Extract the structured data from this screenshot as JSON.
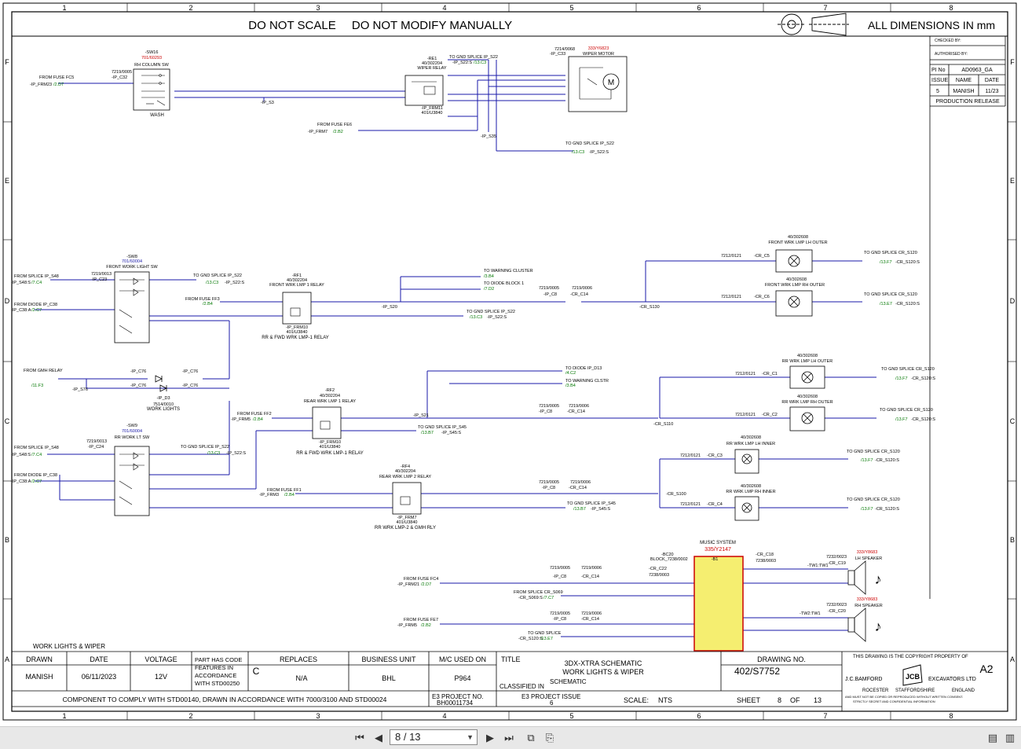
{
  "header": {
    "do_not_scale": "DO NOT SCALE",
    "do_not_modify": "DO NOT MODIFY MANUALLY",
    "dimensions": "ALL DIMENSIONS IN mm"
  },
  "grid": {
    "columns": [
      "1",
      "2",
      "3",
      "4",
      "5",
      "6",
      "7",
      "8"
    ],
    "rows": [
      "F",
      "E",
      "D",
      "C",
      "B",
      "A"
    ]
  },
  "revision_block": {
    "checked_by": "CHECKED BY:",
    "authorised_by": "AUTHORISED BY:",
    "pi_no_label": "PI No",
    "pi_no": "AD0963_GA",
    "issue_label": "ISSUE",
    "name_label": "NAME",
    "date_label": "DATE",
    "issue": "5",
    "name": "MANISH",
    "date": "11/23",
    "production_release": "PRODUCTION RELEASE"
  },
  "sheet_label": "WORK LIGHTS & WIPER",
  "components": {
    "sw16": {
      "ref": "-SW16",
      "part": "701/60293",
      "name": "RH COLUMN SW",
      "sub": "WASH"
    },
    "re1": {
      "ref": "-RE1",
      "part": "40/302204",
      "name": "WIPER RELAY",
      "conn": "-IP_FRM11",
      "conn_part": "401/U3840"
    },
    "wiper_motor": {
      "ref": "-IP_C33",
      "code": "7214/0068",
      "part": "333/Y6823",
      "name": "WIPER MOTOR"
    },
    "sw8": {
      "ref": "-SW8",
      "part": "701/60004",
      "name": "FRONT WORK LIGHT SW"
    },
    "rf1": {
      "ref": "-RF1",
      "part": "40/302204",
      "name": "FRONT WRK LMP 1 RELAY",
      "conn": "-IP_FRM10",
      "conn_part": "401/U3840",
      "caption": "RR & FWD WRK LMP-1 RELAY"
    },
    "d3": {
      "ref": "-IP_D3",
      "part": "7514/0010",
      "name": "WORK LIGHTS"
    },
    "sw9": {
      "ref": "-SW9",
      "part": "701/60004",
      "name": "RR WORK LT SW"
    },
    "rf2": {
      "ref": "-RF2",
      "part": "40/302204",
      "name": "REAR WRK LMP 1 RELAY",
      "conn": "-IP_FRM10",
      "conn_part": "401/U3840",
      "caption": "RR & FWD WRK LMP-1 RELAY"
    },
    "rf4": {
      "ref": "-RF4",
      "part": "40/302204",
      "name": "REAR WRK LMP 2 RELAY",
      "conn": "-IP_FRM7",
      "conn_part": "401/U3840",
      "caption": "RR WRK LMP-2 & GMH RLY"
    },
    "lamps": [
      {
        "part": "40/302608",
        "name": "FRONT WRK LMP LH OUTER",
        "conn": "-CR_C5"
      },
      {
        "part": "40/302608",
        "name": "FRONT WRK LMP RH OUTER",
        "conn": "-CR_C6"
      },
      {
        "part": "40/302608",
        "name": "RR WRK LMP LH OUTER",
        "conn": "-CR_C1"
      },
      {
        "part": "40/302608",
        "name": "RR WRK LMP RH OUTER",
        "conn": "-CR_C2"
      },
      {
        "part": "40/302608",
        "name": "RR WRK LMP LH INNER",
        "conn": "-CR_C3"
      },
      {
        "part": "40/302608",
        "name": "RR WRK LMP RH INNER",
        "conn": "-CR_C4"
      }
    ],
    "music": {
      "title": "MUSIC SYSTEM",
      "part": "335/Y2147",
      "ref": "-B1",
      "bc": "-BC20",
      "block": "BLOCK_7238/0002"
    },
    "lh_speaker": {
      "part": "333/Y8683",
      "name": "LH SPEAKER",
      "conn": "-CR_C19"
    },
    "rh_speaker": {
      "part": "333/Y8683",
      "name": "RH SPEAKER",
      "conn": "-CR_C20"
    }
  },
  "refs": {
    "from_fuse_fc5": "FROM FUSE FC5",
    "ip_frm23": "-IP_FRM23",
    "ref_2d7": "/2.D7",
    "from_fuse_fe6": "FROM FUSE FE6",
    "ip_frm7": "-IP_FRM7",
    "ref_2b2": "/2.B2",
    "to_gnd_splice_ip_s22": "TO GND SPLICE IP_S22",
    "ref_13c3": "/13.C3",
    "ip_s22s": "-IP_S22:S",
    "ip_s3": "-IP_S3",
    "ip_s35": "-IP_S35",
    "ip_s20": "-IP_S20",
    "ip_s21": "-IP_S21",
    "ip_s76": "-IP_S76",
    "from_splice_ip_s48": "FROM SPLICE IP_S48",
    "ip_s48s": "-IP_S48:S",
    "ref_7c4": "/7.C4",
    "from_diode_ip_c38": "FROM DIODE IP_C38",
    "ip_c38a": "-IP_C38:A",
    "ref_2c7": "/2.C7",
    "from_fuse_ff3": "FROM FUSE FF3",
    "ref_2b4": "/2.B4",
    "to_warning_cluster": "TO WARNING CLUSTER",
    "ref_3b4": "/3.B4",
    "to_diode_block1": "TO DIODE BLOCK 1",
    "ref_7d2": "/7.D2",
    "from_gmh_relay": "FROM GMH RELAY",
    "ref_11f3": "/11.F3",
    "ip_c76": "-IP_C76",
    "to_diode_ip_d13": "TO DIODE IP_D13",
    "ref_4c2": "/4.C2",
    "to_warning_clstr": "TO WARNING CLSTR",
    "from_fuse_ff2": "FROM FUSE FF2",
    "ip_frm5": "-IP_FRM5",
    "to_gnd_splice_ip_s45": "TO GND SPLICE IP_S45",
    "ref_13b7": "/13.B7",
    "ip_s45s": "-IP_S45:S",
    "from_fuse_ff1": "FROM FUSE FF1",
    "ip_frm3": "-IP_FRM3",
    "cr_s130": "-CR_S130",
    "cr_s110": "-CR_S110",
    "cr_s100": "-CR_S100",
    "to_gnd_splice_cr_s120": "TO GND SPLICE CR_S120",
    "ref_13f7": "/13.F7",
    "ref_13e7": "/13.E7",
    "cr_s120s": "-CR_S120:S",
    "ip_c8": "-IP_C8",
    "cr_c14": "-CR_C14",
    "ip_c23": "-IP_C23",
    "ip_c24": "-IP_C24",
    "ip_c32": "-IP_C32",
    "code_7219_0005": "7219/0005",
    "code_7219_0006": "7219/0006",
    "code_7219_0013": "7219/0013",
    "code_7212_0121": "7212/0121",
    "from_fuse_fc4": "FROM FUSE FC4",
    "ip_frm21": "-IP_FRM21",
    "from_splice_cr_s069": "FROM SPLICE CR_S069",
    "cr_s069s": "-CR_S069:S",
    "from_fuse_fe7": "FROM FUSE FE7",
    "ip_frm5b": "-IP_FRM5",
    "to_gnd_splice": "TO GND SPLICE",
    "cr_s120s_b": "-CR_S120:S",
    "cr_c22": "-CR_C22",
    "cr_c18": "-CR_C18",
    "code_7238_0003": "7238/0003",
    "tw1": "-TW1:TW1",
    "tw2": "-TW2:TW1",
    "code_7232_0023": "7232/0023"
  },
  "title_block": {
    "drawn_label": "DRAWN",
    "date_label": "DATE",
    "voltage_label": "VOLTAGE",
    "part_code_note": [
      "PART HAS CODE",
      "FEATURES IN",
      "ACCORDANCE",
      "WITH STD00250"
    ],
    "part_code_letter": "C",
    "replaces_label": "REPLACES",
    "business_unit_label": "BUSINESS UNIT",
    "mc_used_on_label": "M/C USED ON",
    "title_label": "TITLE",
    "drawing_no_label": "DRAWING NO.",
    "drawn": "MANISH",
    "date": "06/11/2023",
    "voltage": "12V",
    "replaces": "N/A",
    "business_unit": "BHL",
    "mc_used_on": "P964",
    "title_line1": "3DX-XTRA SCHEMATIC",
    "title_line2": "WORK LIGHTS & WIPER",
    "classified_in_label": "CLASSIFIED IN",
    "classified_in": "SCHEMATIC",
    "drawing_no": "402/S7752",
    "compliance": "COMPONENT TO COMPLY WITH STD00140, DRAWN IN ACCORDANCE WITH 7000/3100 AND STD00024",
    "e3_project_no_label": "E3 PROJECT NO.",
    "e3_project_no": "BH00011734",
    "e3_project_issue_label": "E3 PROJECT ISSUE",
    "e3_project_issue": "6",
    "scale_label": "SCALE:",
    "scale": "NTS",
    "sheet_label": "SHEET",
    "sheet": "8",
    "of_label": "OF",
    "sheets_total": "13",
    "copyright": "THIS DRAWING IS THE COPYRIGHT PROPERTY OF",
    "paper_size": "A2",
    "company": "J.C.BAMFORD",
    "company2": "EXCAVATORS LTD",
    "logo_text": "JCB",
    "address": [
      "ROCESTER",
      "STAFFORDSHIRE",
      "ENGLAND"
    ],
    "legal1": "AND MUST NOT BE COPIED OR REPRODUCED WITHOUT WRITTEN CONSENT.",
    "legal2": "STRICTLY SECRET AND CONFIDENTIAL INFORMATION"
  },
  "viewer": {
    "page_indicator": "8 / 13"
  },
  "colors": {
    "wire": "#1a1aa8",
    "ref_green": "#007700",
    "part_red": "#cc0000",
    "part_blue": "#1a1aa8",
    "music_fill": "#f5ee70",
    "music_border": "#cc0000"
  }
}
